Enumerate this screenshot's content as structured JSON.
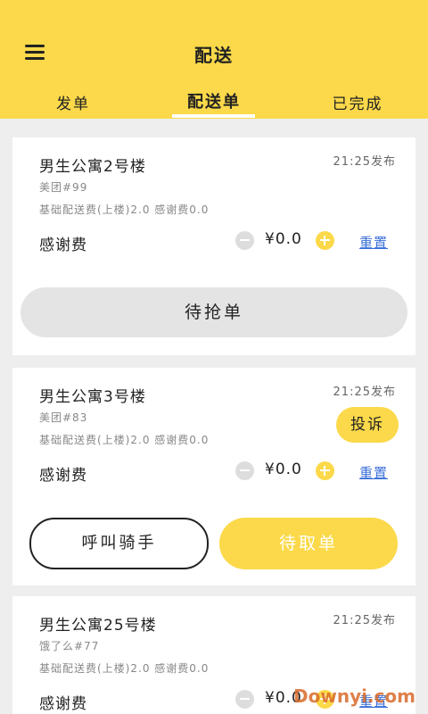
{
  "header": {
    "title": "配送",
    "tabs": [
      "发单",
      "配送单",
      "已完成"
    ]
  },
  "orders": [
    {
      "title": "男生公寓2号楼",
      "time": "21:25发布",
      "shop": "美团#99",
      "fee": "基础配送费(上楼)2.0 感谢费0.0",
      "tip_label": "感谢费",
      "amount": "¥0.0",
      "reset": "重置",
      "action": "待抢单"
    },
    {
      "title": "男生公寓3号楼",
      "time": "21:25发布",
      "shop": "美团#83",
      "fee": "基础配送费(上楼)2.0 感谢费0.0",
      "tip_label": "感谢费",
      "amount": "¥0.0",
      "reset": "重置",
      "complain": "投诉",
      "call": "呼叫骑手",
      "action": "待取单"
    },
    {
      "title": "男生公寓25号楼",
      "time": "21:25发布",
      "shop": "饿了么#77",
      "fee": "基础配送费(上楼)2.0 感谢费0.0",
      "tip_label": "感谢费",
      "amount": "¥0.0",
      "reset": "重置"
    }
  ],
  "watermark": "Downyi.com",
  "colors": {
    "accent": "#fbd94a",
    "link": "#3a6fd8",
    "background": "#eeeeee"
  }
}
